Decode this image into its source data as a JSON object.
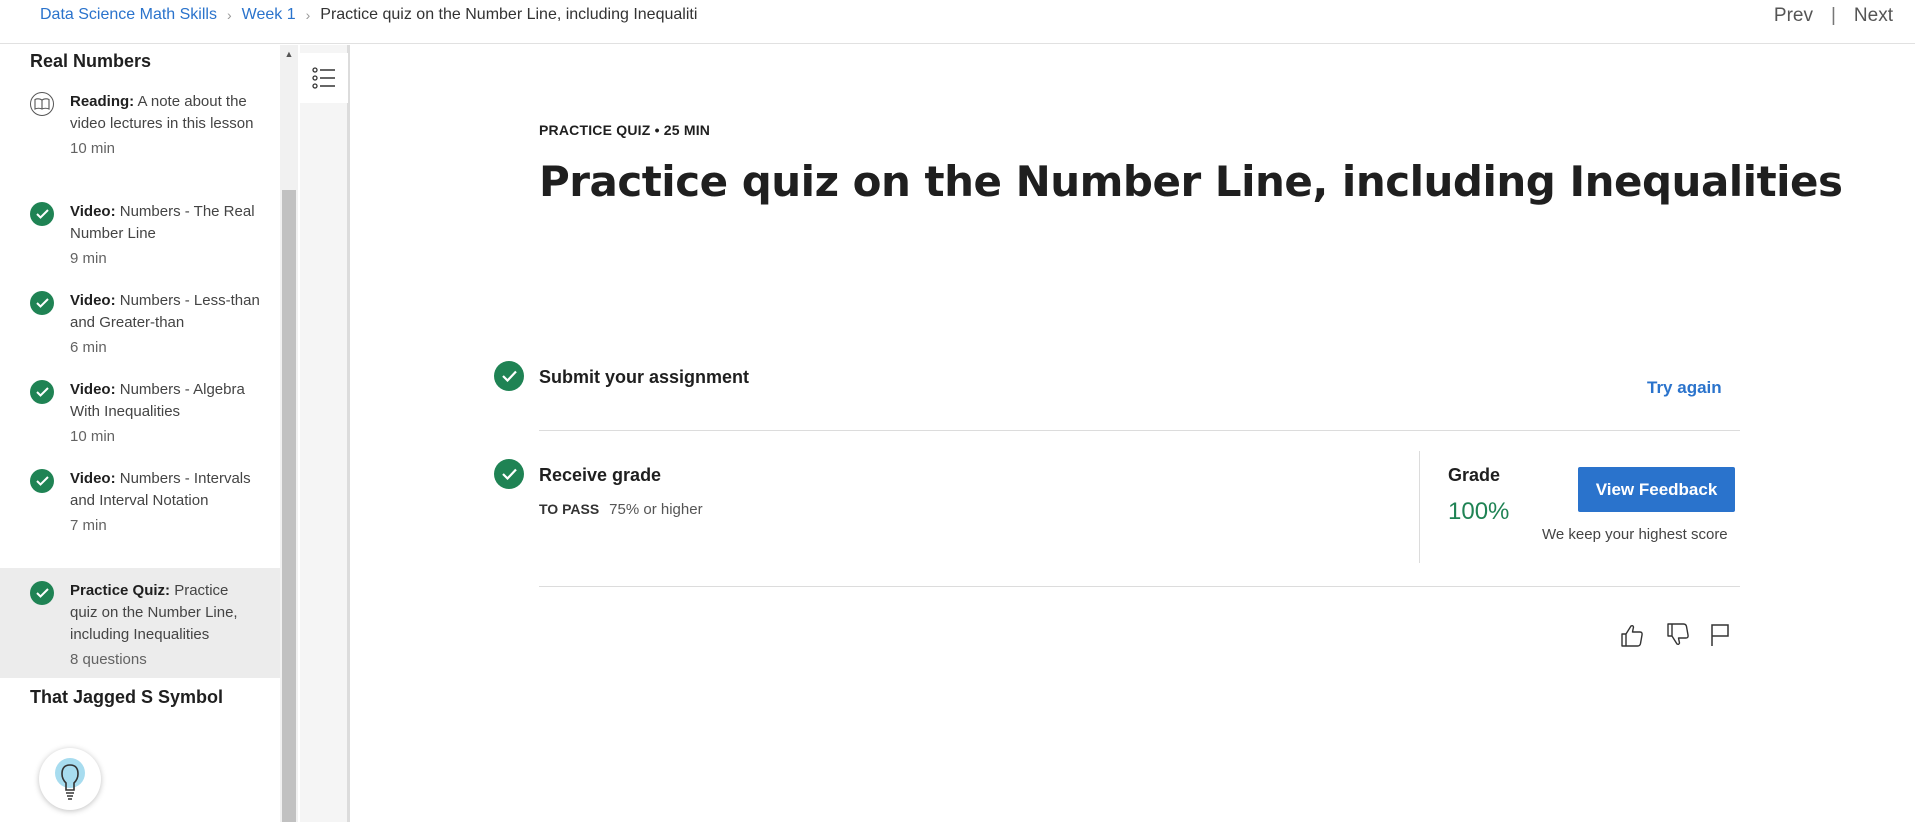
{
  "breadcrumb": {
    "course": "Data Science Math Skills",
    "week": "Week 1",
    "current": "Practice quiz on the Number Line, including Inequalities"
  },
  "nav": {
    "prev": "Prev",
    "sep": "|",
    "next": "Next"
  },
  "sidebar": {
    "section1": "Real Numbers",
    "items": [
      {
        "kind": "Reading:",
        "title": "A note about the video lectures in this lesson",
        "duration": "10 min",
        "icon": "book-icon",
        "active": false
      },
      {
        "kind": "Video:",
        "title": "Numbers - The Real Number Line",
        "duration": "9 min",
        "icon": "check-icon",
        "active": false
      },
      {
        "kind": "Video:",
        "title": "Numbers - Less-than and Greater-than",
        "duration": "6 min",
        "icon": "check-icon",
        "active": false
      },
      {
        "kind": "Video:",
        "title": "Numbers - Algebra With Inequalities",
        "duration": "10 min",
        "icon": "check-icon",
        "active": false
      },
      {
        "kind": "Video:",
        "title": "Numbers - Intervals and Interval Notation",
        "duration": "7 min",
        "icon": "check-icon",
        "active": false
      },
      {
        "kind": "Practice Quiz:",
        "title": "Practice quiz on the Number Line, including Inequalities",
        "duration": "8 questions",
        "icon": "check-icon",
        "active": true
      }
    ],
    "section2": "That Jagged S Symbol"
  },
  "main": {
    "meta": "PRACTICE QUIZ • 25 MIN",
    "title": "Practice quiz on the Number Line, including Inequalities",
    "submit": {
      "label": "Submit your assignment",
      "action": "Try again"
    },
    "receive": {
      "label": "Receive grade",
      "to_pass_label": "TO PASS",
      "to_pass_value": "75% or higher",
      "grade_label": "Grade",
      "grade_value": "100%",
      "feedback_button": "View Feedback",
      "note": "We keep your highest score"
    }
  },
  "colors": {
    "accent": "#2a73cc",
    "success": "#1f8354"
  }
}
